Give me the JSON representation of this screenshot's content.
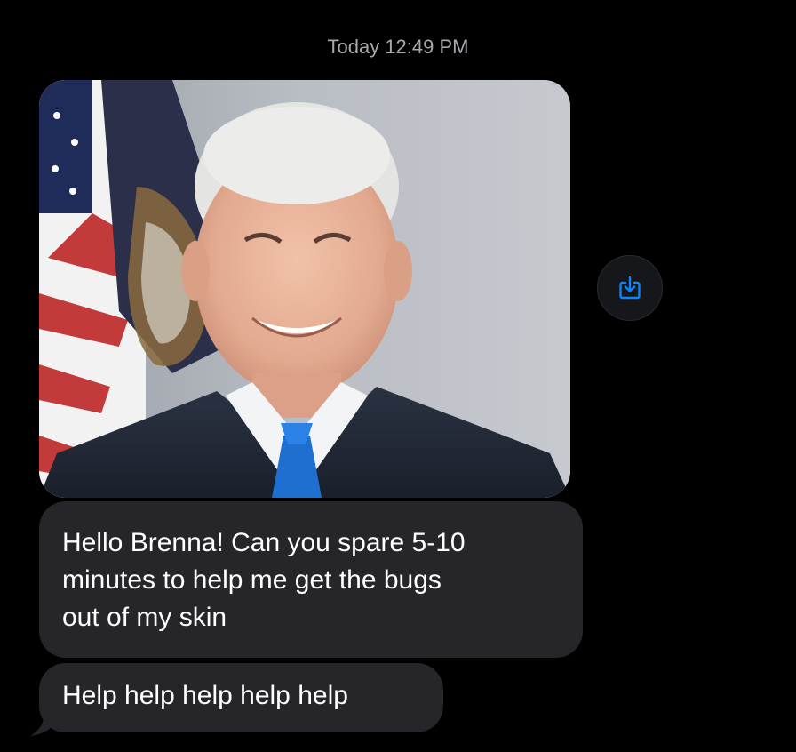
{
  "conversation": {
    "timestamp": "Today 12:49 PM"
  },
  "attachment": {
    "type": "photo",
    "save_icon": "save-to-device-icon",
    "accent_color": "#0a84ff"
  },
  "messages": [
    {
      "lines": [
        "Hello Brenna! Can you spare 5-10",
        "minutes to help me get the bugs",
        "out of my skin"
      ]
    },
    {
      "text": "Help help help help help"
    }
  ],
  "colors": {
    "background": "#000000",
    "incoming_bubble": "#26262a",
    "timestamp_text": "#a8a8ad"
  }
}
